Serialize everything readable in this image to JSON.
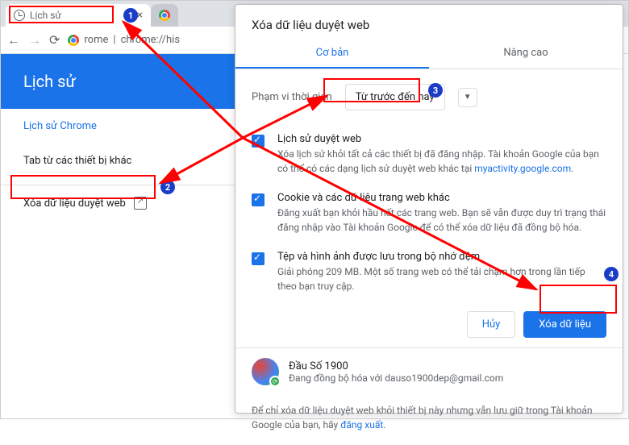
{
  "tab": {
    "title": "Lịch sử"
  },
  "addressbar": {
    "host": "rome",
    "path": "chrome://his"
  },
  "header": {
    "title": "Lịch sử"
  },
  "sidebar": {
    "items": [
      {
        "label": "Lịch sử Chrome"
      },
      {
        "label": "Tab từ các thiết bị khác"
      }
    ],
    "clear_label": "Xóa dữ liệu duyệt web"
  },
  "dialog": {
    "title": "Xóa dữ liệu duyệt web",
    "tabs": {
      "basic": "Cơ bản",
      "advanced": "Nâng cao"
    },
    "range_label": "Phạm vi thời gian",
    "range_value": "Từ trước đến nay",
    "items": [
      {
        "title": "Lịch sử duyệt web",
        "desc_a": "Xóa lịch sử khỏi tất cả các thiết bị đã đăng nhập. Tài khoản Google của bạn có thể có các dạng lịch sử duyệt web khác tại ",
        "link": "myactivity.google.com",
        "desc_b": "."
      },
      {
        "title": "Cookie và các dữ liệu trang web khác",
        "desc_a": "Đăng xuất bạn khỏi hầu hết các trang web. Bạn sẽ vẫn được duy trì trạng thái đăng nhập vào Tài khoản Google để có thể xóa dữ liệu đã đồng bộ hóa."
      },
      {
        "title": "Tệp và hình ảnh được lưu trong bộ nhớ đệm",
        "desc_a": "Giải phóng 209 MB. Một số trang web có thể tải chậm hơn trong lần tiếp theo bạn truy cập."
      }
    ],
    "buttons": {
      "cancel": "Hủy",
      "confirm": "Xóa dữ liệu"
    },
    "account": {
      "name": "Đầu Số 1900",
      "status": "Đang đồng bộ hóa với dauso1900dep@gmail.com"
    },
    "footnote_a": "Để chỉ xóa dữ liệu duyệt web khỏi thiết bị này nhưng vẫn lưu giữ trong Tài khoản Google của bạn, hãy ",
    "footnote_link": "đăng xuất",
    "footnote_b": "."
  },
  "annotations": {
    "b1": "1",
    "b2": "2",
    "b3": "3",
    "b4": "4"
  }
}
